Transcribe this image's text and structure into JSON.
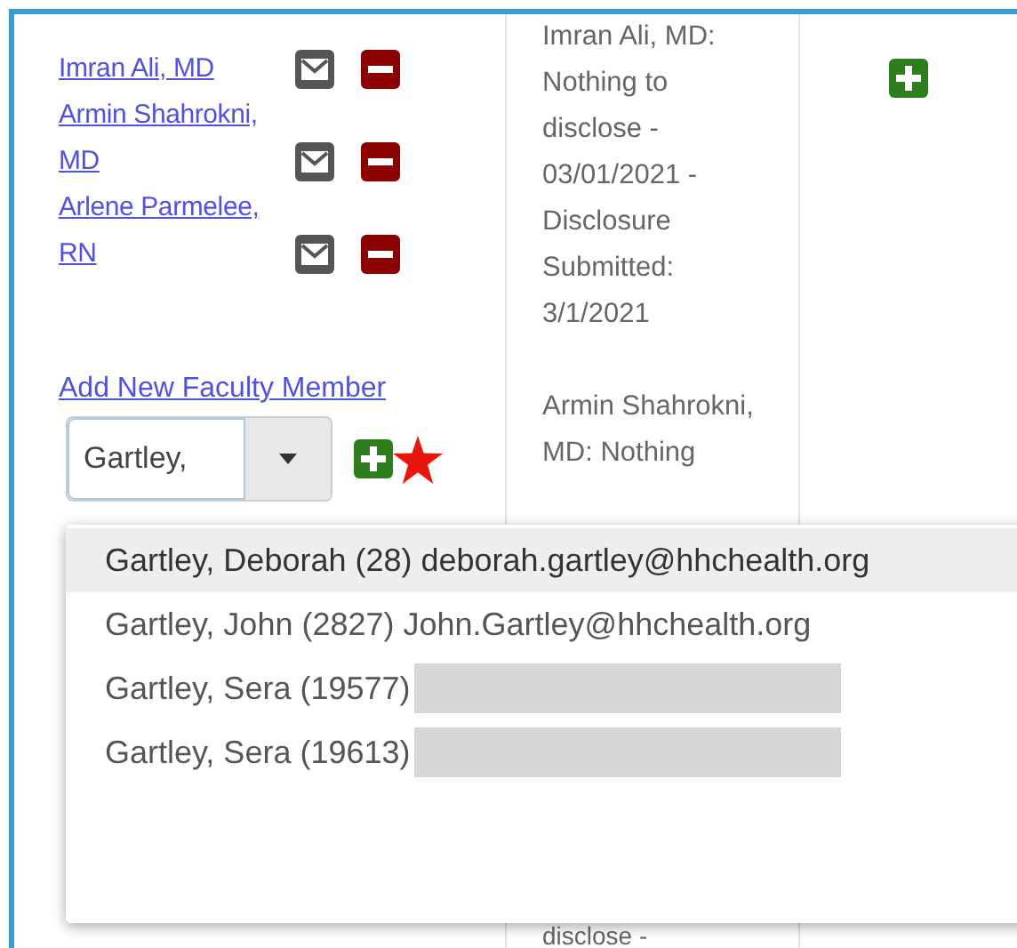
{
  "faculty": [
    {
      "name": "Imran Ali, MD"
    },
    {
      "name": "Armin Shahrokni, MD"
    },
    {
      "name": "Arlene Parmelee, RN"
    }
  ],
  "add_link": "Add New Faculty Member",
  "faculty_combo": {
    "value": "Gartley,",
    "required": true
  },
  "disclosures": [
    "Imran Ali, MD: Nothing to disclose - 03/01/2021 - Disclosure Submitted: 3/1/2021",
    "Armin Shahrokni, MD: Nothing"
  ],
  "disclosure_fragment": "disclose -",
  "dropdown": [
    {
      "label": "Gartley, Deborah (28) deborah.gartley@hhchealth.org",
      "selected": true,
      "redacted": false
    },
    {
      "label": "Gartley, John (2827) John.Gartley@hhchealth.org",
      "selected": false,
      "redacted": false
    },
    {
      "label": "Gartley, Sera (19577)",
      "selected": false,
      "redacted": true
    },
    {
      "label": "Gartley, Sera (19613)",
      "selected": false,
      "redacted": true
    }
  ]
}
